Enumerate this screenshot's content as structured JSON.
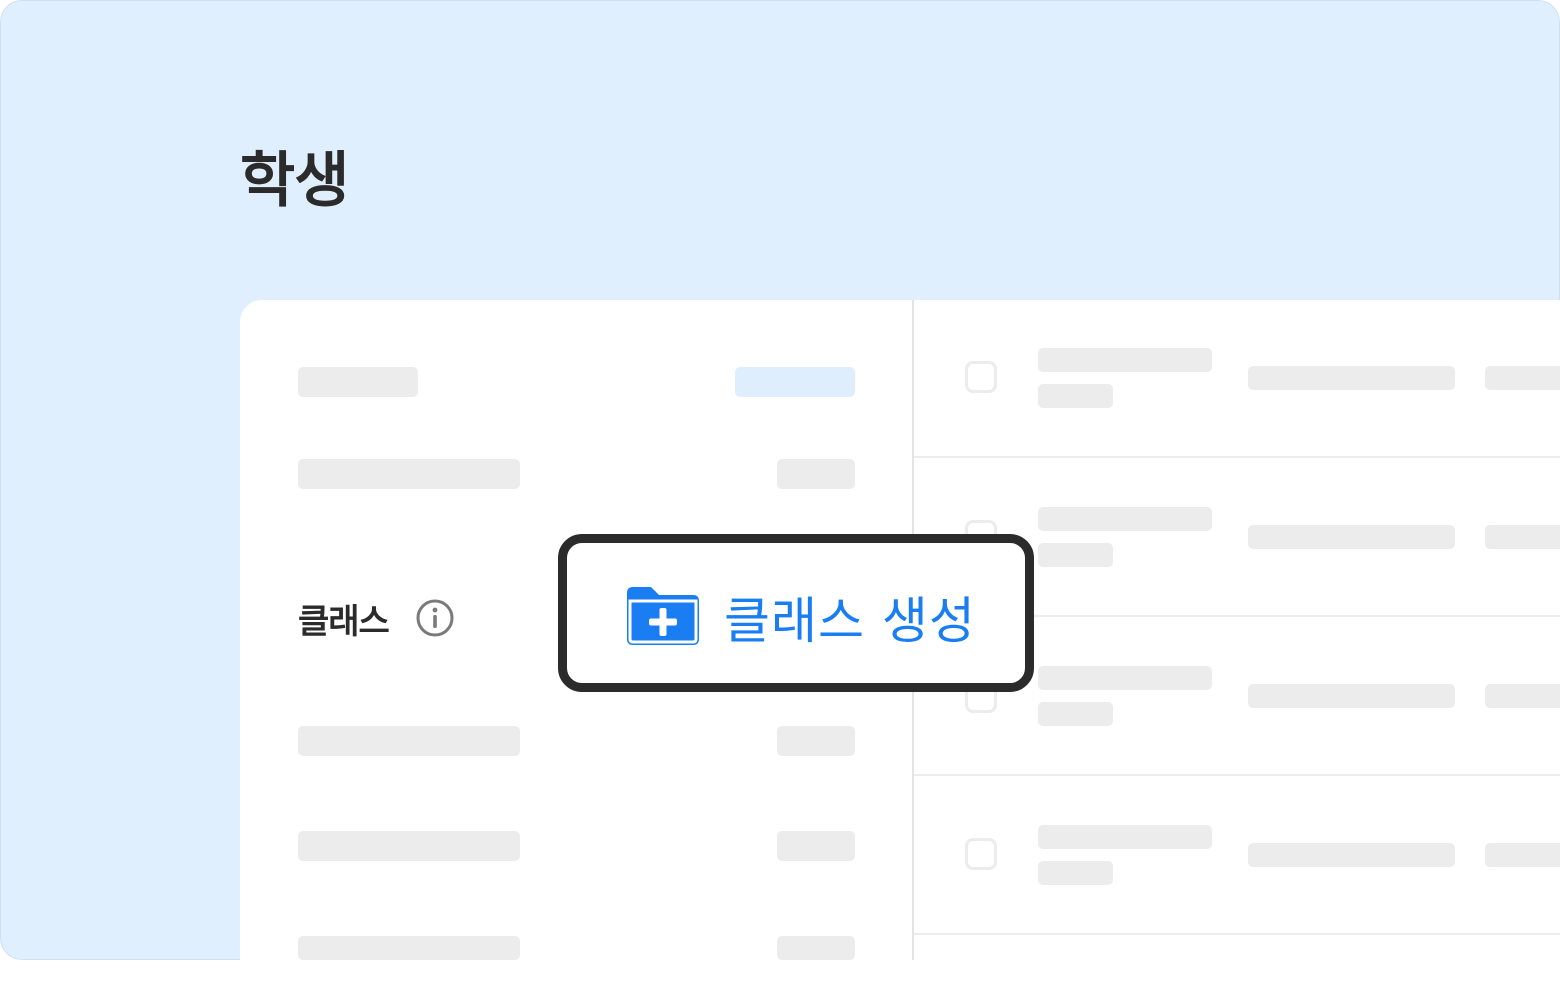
{
  "header": {
    "title": "학생"
  },
  "sidebar": {
    "class_section_label": "클래스",
    "info_icon": "info-circle-icon"
  },
  "cta": {
    "label": "클래스 생성",
    "icon": "folder-plus-icon",
    "color": "#1a7ef2"
  },
  "colors": {
    "background": "#e0effe",
    "card": "#ffffff",
    "skeleton": "#ececec",
    "skeleton_accent": "#dfeefd",
    "text": "#2b2b2b"
  },
  "student_list": {
    "visible_rows": 4
  }
}
